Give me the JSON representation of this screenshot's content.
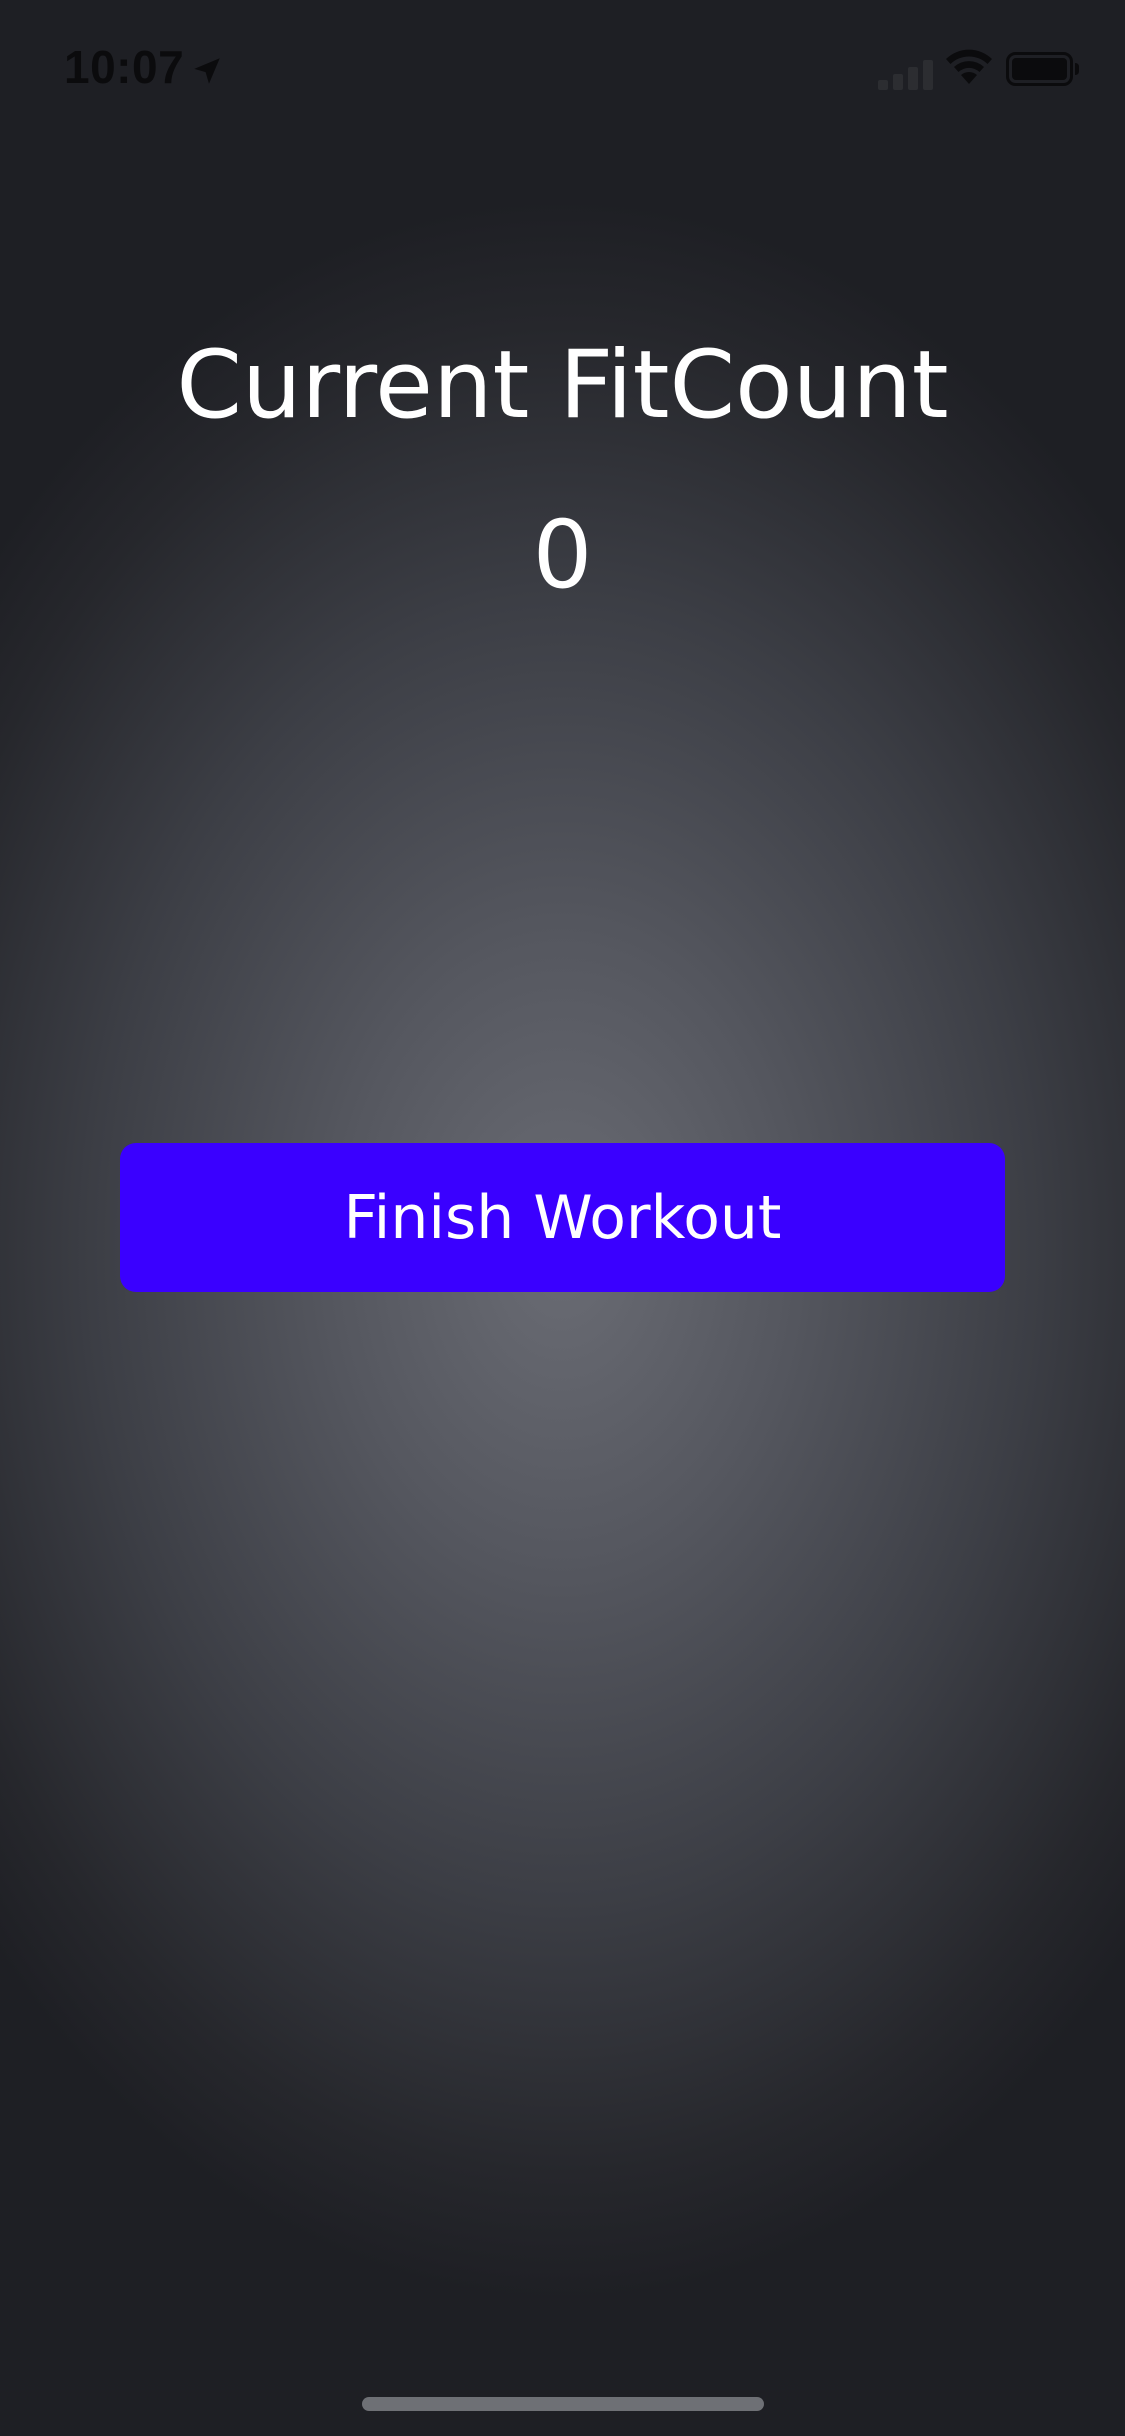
{
  "status_bar": {
    "time": "10:07",
    "icons": [
      "location-arrow-icon",
      "cellular-signal-icon",
      "wifi-icon",
      "battery-icon"
    ]
  },
  "main": {
    "title": "Current FitCount",
    "count": "0"
  },
  "actions": {
    "finish_label": "Finish Workout"
  },
  "colors": {
    "button": "#3a00ff",
    "text": "#ffffff",
    "status_text": "#0b0b0d"
  }
}
